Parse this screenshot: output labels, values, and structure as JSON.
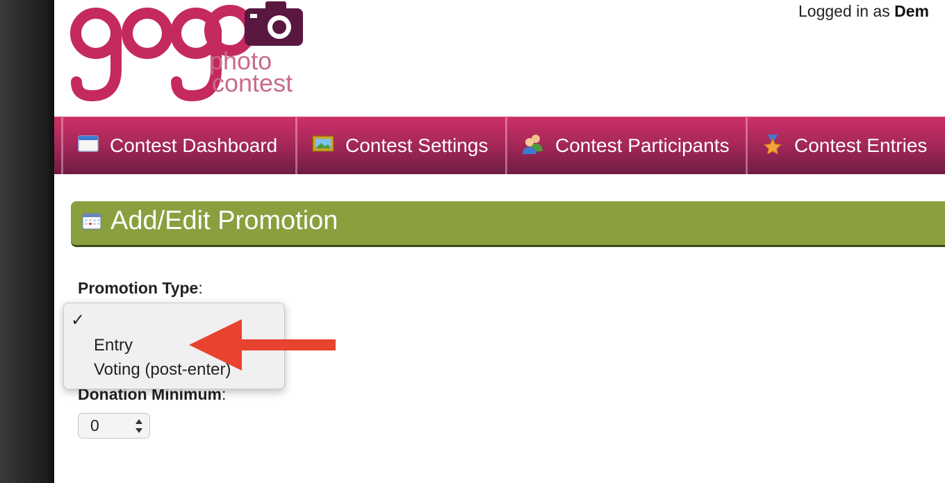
{
  "header": {
    "logo": {
      "word": "gogo",
      "tagline_1": "photo",
      "tagline_2": "contest"
    },
    "logged_in_prefix": "Logged in as ",
    "logged_in_user": "Dem"
  },
  "nav": [
    {
      "label": "Contest Dashboard",
      "icon": "window-icon"
    },
    {
      "label": "Contest Settings",
      "icon": "picture-icon"
    },
    {
      "label": "Contest Participants",
      "icon": "users-icon"
    },
    {
      "label": "Contest Entries",
      "icon": "star-icon"
    }
  ],
  "page": {
    "title": "Add/Edit Promotion",
    "title_icon": "calendar-icon"
  },
  "form": {
    "promotion_type_label": "Promotion Type",
    "colon": ":",
    "promotion_type_options": [
      {
        "label": "",
        "checked": true
      },
      {
        "label": "Entry"
      },
      {
        "label": "Voting (post-enter)"
      }
    ],
    "donation_label": "Donation Minimum",
    "donation_value": "0"
  },
  "colors": {
    "nav_top": "#cc2f66",
    "nav_bottom": "#6e1c44",
    "panel": "#8a9f3e",
    "annotation_arrow": "#e8432e",
    "logo_pink": "#c42a5f"
  }
}
